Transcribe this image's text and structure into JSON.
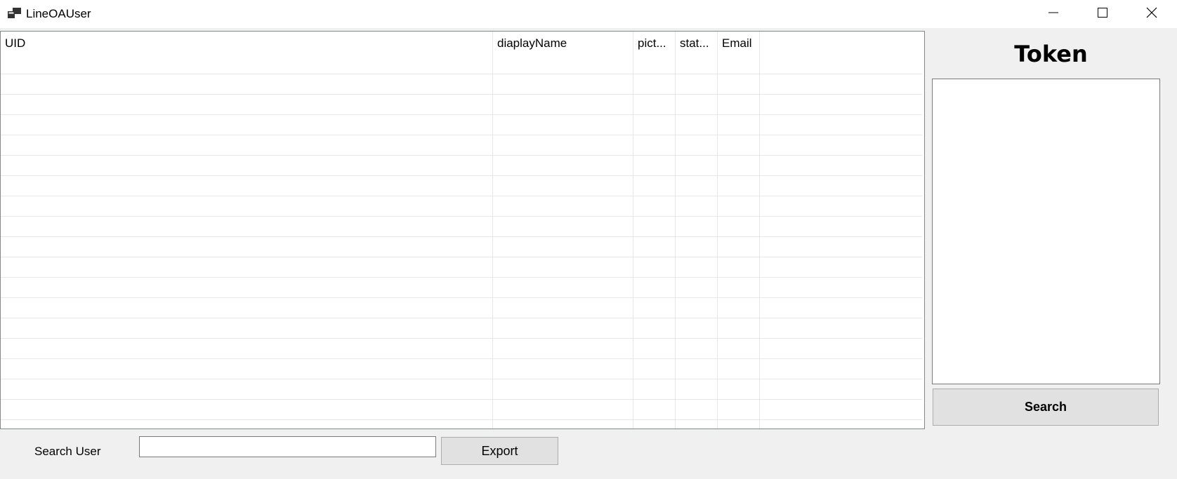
{
  "window": {
    "title": "LineOAUser",
    "icon": "app-window-icon",
    "controls": [
      "minimize-icon",
      "maximize-icon",
      "close-icon"
    ]
  },
  "grid": {
    "columns": [
      {
        "label": "UID"
      },
      {
        "label": "diaplayName"
      },
      {
        "label": "pict..."
      },
      {
        "label": "stat..."
      },
      {
        "label": "Email"
      }
    ],
    "rows": []
  },
  "token_panel": {
    "title": "Token",
    "value": "",
    "search_label": "Search"
  },
  "bottom_bar": {
    "search_user_label": "Search User",
    "search_value": "",
    "export_label": "Export"
  }
}
